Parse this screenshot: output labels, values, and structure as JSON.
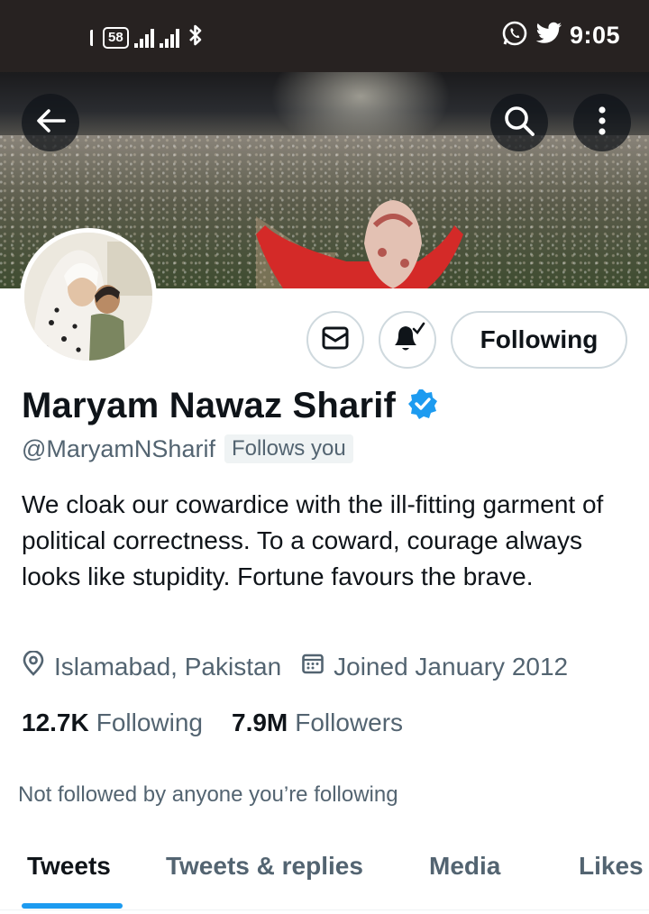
{
  "status_bar": {
    "battery": "58",
    "time": "9:05"
  },
  "profile": {
    "name": "Maryam Nawaz Sharif",
    "handle": "@MaryamNSharif",
    "follows_you": "Follows you",
    "bio": "We cloak our cowardice with the ill-fitting garment of political correctness. To a coward, courage always looks like stupidity. Fortune favours the brave.",
    "location": "Islamabad, Pakistan",
    "joined": "Joined January 2012",
    "following_count": "12.7K",
    "following_label": "Following",
    "followers_count": "7.9M",
    "followers_label": "Followers",
    "not_followed_text": "Not followed by anyone you’re following",
    "verified": true
  },
  "actions": {
    "follow_button_label": "Following"
  },
  "tabs": [
    {
      "label": "Tweets",
      "active": true
    },
    {
      "label": "Tweets & replies",
      "active": false
    },
    {
      "label": "Media",
      "active": false
    },
    {
      "label": "Likes",
      "active": false
    }
  ],
  "colors": {
    "accent": "#1d9bf0",
    "status_bar_bg": "#272221",
    "secondary_text": "#536471",
    "border": "#cfd9de"
  },
  "icons": {
    "back": "back-arrow-icon",
    "search": "search-icon",
    "more": "more-vertical-icon",
    "message": "envelope-icon",
    "notifications": "bell-check-icon",
    "location": "location-pin-icon",
    "calendar": "calendar-icon",
    "verified": "verified-badge-icon"
  }
}
